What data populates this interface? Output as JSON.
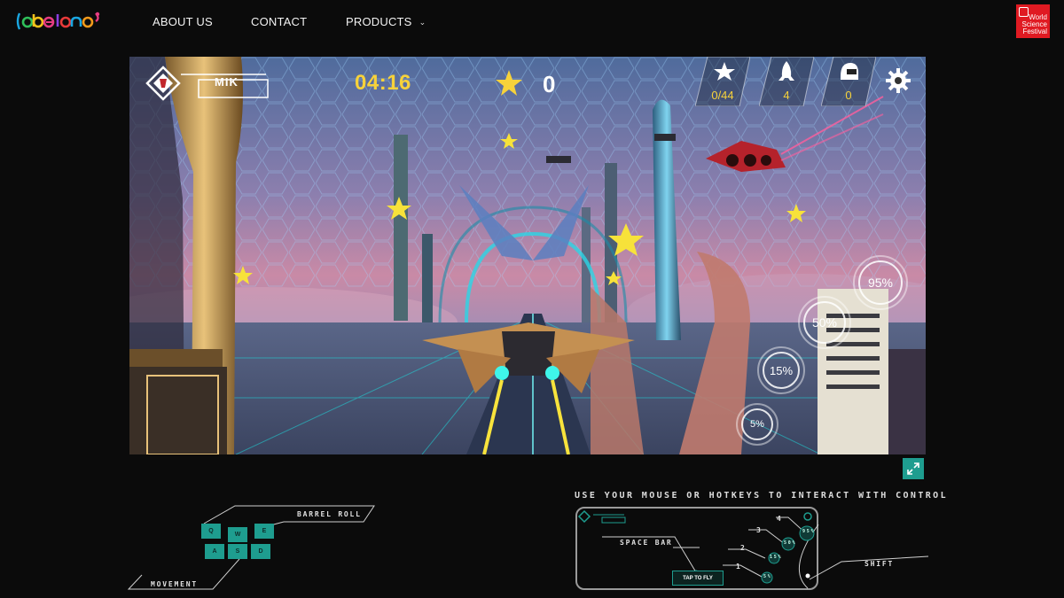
{
  "site": {
    "logo_text": "abelona",
    "logo_colors": [
      "#1aa6e0",
      "#2fbf5a",
      "#f2c21b",
      "#e63c82",
      "#8a3fe0",
      "#e83a3a",
      "#f29a1b"
    ],
    "nav": [
      {
        "label": "ABOUT US"
      },
      {
        "label": "CONTACT"
      },
      {
        "label": "PRODUCTS",
        "has_dropdown": true
      }
    ],
    "partner_logo": {
      "lines": [
        "World",
        "Science",
        "Festival"
      ],
      "color": "#e01a22"
    }
  },
  "game": {
    "player_name": "MIK",
    "timer": "04:16",
    "score": "0",
    "stats": [
      {
        "icon": "star-icon",
        "value": "0/44"
      },
      {
        "icon": "rocket-icon",
        "value": "4"
      },
      {
        "icon": "helmet-icon",
        "value": "0"
      }
    ],
    "thrust_buttons": [
      {
        "label": "95%"
      },
      {
        "label": "50%"
      },
      {
        "label": "15%"
      },
      {
        "label": "5%"
      }
    ],
    "accent": "#f7d23a",
    "teal": "#1e9d8f"
  },
  "controls": {
    "title": "USE YOUR MOUSE OR HOTKEYS TO INTERACT WITH CONTROL",
    "keys_top": [
      "Q",
      "W",
      "E"
    ],
    "keys_bottom": [
      "A",
      "S",
      "D"
    ],
    "barrel_roll_label": "BARREL ROLL",
    "movement_label": "MOVEMENT",
    "space_label": "SPACE BAR",
    "shift_label": "SHIFT",
    "tap_to_fly": "TAP TO FLY",
    "level_numbers": [
      "4",
      "3",
      "2",
      "1"
    ],
    "panel_pcts": [
      "95%",
      "50%",
      "15%",
      "5%"
    ]
  }
}
